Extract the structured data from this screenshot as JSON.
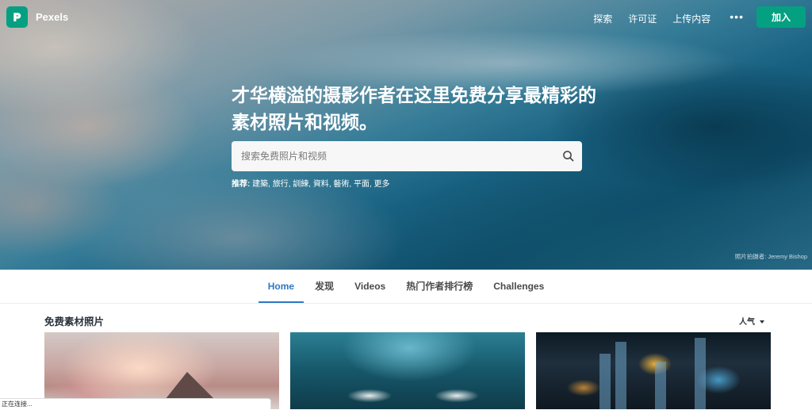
{
  "nav": {
    "logo_text": "Pexels",
    "links": [
      "探索",
      "许可证",
      "上传内容"
    ],
    "more": "•••",
    "join_label": "加入"
  },
  "hero": {
    "headline": "才华横溢的摄影作者在这里免费分享最精彩的素材照片和视频。",
    "search_placeholder": "搜索免费照片和视频",
    "suggest_label": "推荐:",
    "suggestions": [
      "建築",
      "旅行",
      "訓練",
      "資料",
      "藝術",
      "平面",
      "更多"
    ],
    "credit_label": "照片拍摄者:",
    "credit_author": "Jeremy Bishop"
  },
  "tabs": [
    {
      "label": "Home",
      "active": true
    },
    {
      "label": "发现",
      "active": false
    },
    {
      "label": "Videos",
      "active": false
    },
    {
      "label": "热门作者排行榜",
      "active": false
    },
    {
      "label": "Challenges",
      "active": false
    }
  ],
  "section": {
    "title": "免费素材照片",
    "sort_label": "人气"
  },
  "status_text": "正在连接...",
  "colors": {
    "brand": "#05a081",
    "tab_active": "#2f78c4"
  },
  "icons": [
    "pexels-logo-icon",
    "search-icon",
    "caret-down-icon"
  ]
}
